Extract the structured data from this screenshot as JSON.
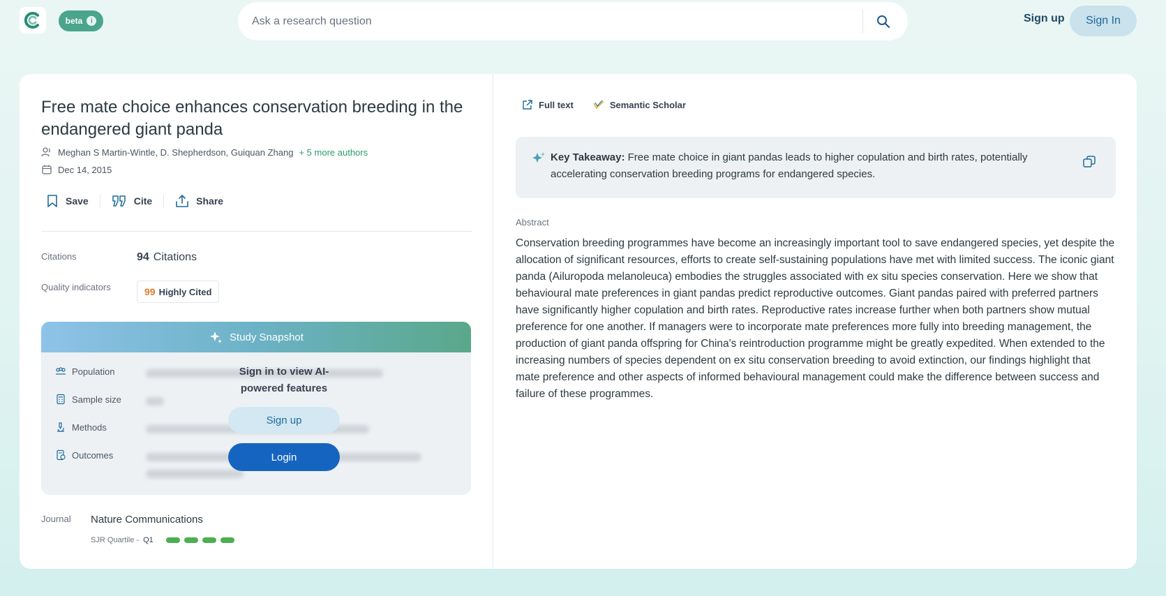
{
  "header": {
    "beta_label": "beta",
    "search_placeholder": "Ask a research question",
    "signup_label": "Sign up",
    "signin_label": "Sign In"
  },
  "paper": {
    "title": "Free mate choice enhances conservation breeding in the endangered giant panda",
    "authors": "Meghan S Martin-Wintle, D. Shepherdson, Guiquan Zhang",
    "more_authors": "+ 5 more authors",
    "date": "Dec 14, 2015"
  },
  "actions": {
    "save": "Save",
    "cite": "Cite",
    "share": "Share"
  },
  "citations": {
    "label": "Citations",
    "count": "94",
    "unit": "Citations"
  },
  "quality": {
    "label": "Quality indicators",
    "badge": "Highly Cited",
    "badge_icon": "99"
  },
  "snapshot": {
    "title": "Study Snapshot",
    "rows": {
      "population": "Population",
      "sample_size": "Sample size",
      "methods": "Methods",
      "outcomes": "Outcomes"
    },
    "locked_message": "Sign in to view AI-powered features",
    "signup_button": "Sign up",
    "login_button": "Login"
  },
  "journal": {
    "label": "Journal",
    "name": "Nature Communications",
    "sjr_label": "SJR Quartile -",
    "quartile": "Q1",
    "quartile_filled": 4
  },
  "links": {
    "full_text": "Full text",
    "semantic_scholar": "Semantic Scholar"
  },
  "takeaway": {
    "label": "Key Takeaway:",
    "text": "Free mate choice in giant pandas leads to higher copulation and birth rates, potentially accelerating conservation breeding programs for endangered species."
  },
  "abstract": {
    "label": "Abstract",
    "text": "Conservation breeding programmes have become an increasingly important tool to save endangered species, yet despite the allocation of significant resources, efforts to create self-sustaining populations have met with limited success. The iconic giant panda (Ailuropoda melanoleuca) embodies the struggles associated with ex situ species conservation. Here we show that behavioural mate preferences in giant pandas predict reproductive outcomes. Giant pandas paired with preferred partners have significantly higher copulation and birth rates. Reproductive rates increase further when both partners show mutual preference for one another. If managers were to incorporate mate preferences more fully into breeding management, the production of giant panda offspring for China's reintroduction programme might be greatly expedited. When extended to the increasing numbers of species dependent on ex situ conservation breeding to avoid extinction, our findings highlight that mate preference and other aspects of informed behavioural management could make the difference between success and failure of these programmes."
  },
  "colors": {
    "accent_green": "#4aa58c",
    "link_blue": "#1565c0",
    "quartile_green": "#4caf50"
  }
}
